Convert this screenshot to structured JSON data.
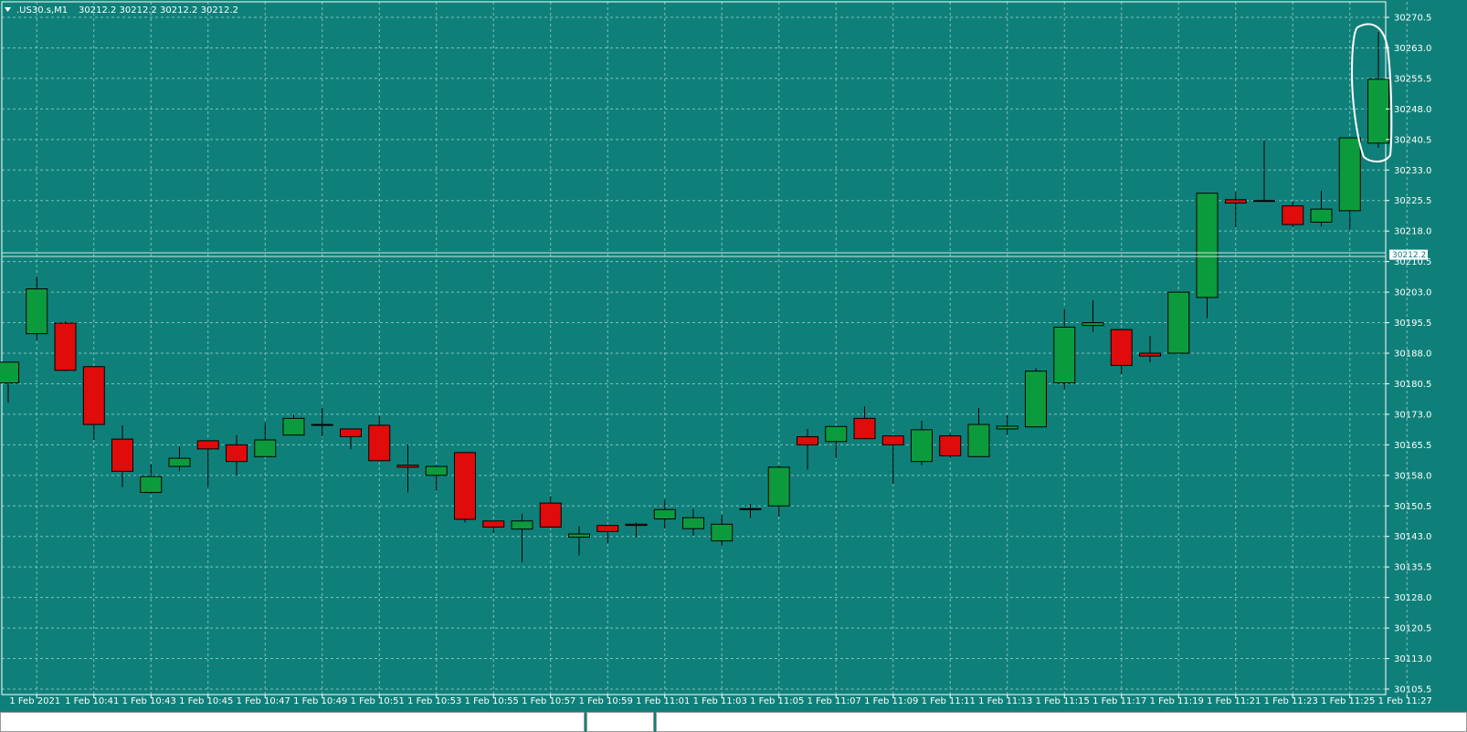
{
  "header": {
    "symbol_label": ".US30.s,M1",
    "ohlc_label": "30212.2 30212.2 30212.2 30212.2",
    "menu_icon": "triangle-down-icon"
  },
  "current_price": {
    "value": 30212.2,
    "label": "30212.2"
  },
  "colors": {
    "background": "#0f8079",
    "grid": "#7fc0bc",
    "bull": "#0c9b3c",
    "bear": "#e00b0b",
    "wick": "#000000",
    "axis_text": "#ffffff",
    "highlight_circle": "#ffffff"
  },
  "chart_data": {
    "type": "candlestick",
    "timeframe": "M1",
    "grid": true,
    "ylim": [
      30105.5,
      30270.5
    ],
    "y_ticks": [
      "30270.5",
      "30263.0",
      "30255.5",
      "30248.0",
      "30240.5",
      "30233.0",
      "30225.5",
      "30218.0",
      "30210.5",
      "30203.0",
      "30195.5",
      "30188.0",
      "30180.5",
      "30173.0",
      "30165.5",
      "30158.0",
      "30150.5",
      "30143.0",
      "30135.5",
      "30128.0",
      "30120.5",
      "30113.0",
      "30105.5"
    ],
    "x_ticks": [
      "1 Feb 2021",
      "1 Feb 10:41",
      "1 Feb 10:43",
      "1 Feb 10:45",
      "1 Feb 10:47",
      "1 Feb 10:49",
      "1 Feb 10:51",
      "1 Feb 10:53",
      "1 Feb 10:55",
      "1 Feb 10:57",
      "1 Feb 10:59",
      "1 Feb 11:01",
      "1 Feb 11:03",
      "1 Feb 11:05",
      "1 Feb 11:07",
      "1 Feb 11:09",
      "1 Feb 11:11",
      "1 Feb 11:13",
      "1 Feb 11:15",
      "1 Feb 11:17",
      "1 Feb 11:19",
      "1 Feb 11:21",
      "1 Feb 11:23",
      "1 Feb 11:25",
      "1 Feb 11:27"
    ],
    "candles": [
      {
        "o": 30180.7,
        "h": 30185.8,
        "l": 30175.9,
        "c": 30185.8
      },
      {
        "o": 30192.8,
        "h": 30206.9,
        "l": 30191.2,
        "c": 30203.8
      },
      {
        "o": 30195.4,
        "h": 30195.8,
        "l": 30183.6,
        "c": 30183.8
      },
      {
        "o": 30184.7,
        "h": 30184.7,
        "l": 30166.7,
        "c": 30170.5
      },
      {
        "o": 30166.9,
        "h": 30170.3,
        "l": 30155.1,
        "c": 30159.0
      },
      {
        "o": 30153.8,
        "h": 30160.8,
        "l": 30153.6,
        "c": 30157.7
      },
      {
        "o": 30160.2,
        "h": 30165.1,
        "l": 30159.0,
        "c": 30162.2
      },
      {
        "o": 30166.5,
        "h": 30166.7,
        "l": 30155.1,
        "c": 30164.5
      },
      {
        "o": 30165.5,
        "h": 30167.9,
        "l": 30158.0,
        "c": 30161.4
      },
      {
        "o": 30162.6,
        "h": 30170.9,
        "l": 30162.6,
        "c": 30166.7
      },
      {
        "o": 30167.9,
        "h": 30173.0,
        "l": 30167.9,
        "c": 30172.0
      },
      {
        "o": 30170.5,
        "h": 30174.6,
        "l": 30167.6,
        "c": 30170.5
      },
      {
        "o": 30169.4,
        "h": 30169.4,
        "l": 30164.4,
        "c": 30167.5
      },
      {
        "o": 30170.3,
        "h": 30172.6,
        "l": 30161.4,
        "c": 30161.6
      },
      {
        "o": 30160.5,
        "h": 30165.6,
        "l": 30153.8,
        "c": 30160.0
      },
      {
        "o": 30158.0,
        "h": 30160.5,
        "l": 30154.2,
        "c": 30160.2
      },
      {
        "o": 30163.6,
        "h": 30163.6,
        "l": 30146.4,
        "c": 30147.2
      },
      {
        "o": 30146.8,
        "h": 30146.8,
        "l": 30143.8,
        "c": 30145.3
      },
      {
        "o": 30144.8,
        "h": 30148.5,
        "l": 30136.6,
        "c": 30146.8
      },
      {
        "o": 30151.2,
        "h": 30152.9,
        "l": 30145.1,
        "c": 30145.3
      },
      {
        "o": 30142.8,
        "h": 30145.5,
        "l": 30138.3,
        "c": 30143.6
      },
      {
        "o": 30145.7,
        "h": 30145.7,
        "l": 30141.4,
        "c": 30144.2
      },
      {
        "o": 30146.0,
        "h": 30146.4,
        "l": 30142.8,
        "c": 30145.7
      },
      {
        "o": 30147.3,
        "h": 30152.0,
        "l": 30144.9,
        "c": 30149.6
      },
      {
        "o": 30144.9,
        "h": 30149.8,
        "l": 30143.2,
        "c": 30147.6
      },
      {
        "o": 30141.9,
        "h": 30148.3,
        "l": 30140.6,
        "c": 30146.0
      },
      {
        "o": 30149.6,
        "h": 30151.0,
        "l": 30147.5,
        "c": 30149.8
      },
      {
        "o": 30150.5,
        "h": 30160.3,
        "l": 30147.9,
        "c": 30160.0
      },
      {
        "o": 30167.5,
        "h": 30169.4,
        "l": 30159.4,
        "c": 30165.5
      },
      {
        "o": 30166.3,
        "h": 30170.0,
        "l": 30162.2,
        "c": 30170.0
      },
      {
        "o": 30172.0,
        "h": 30174.9,
        "l": 30167.0,
        "c": 30167.0
      },
      {
        "o": 30167.7,
        "h": 30167.7,
        "l": 30155.9,
        "c": 30165.5
      },
      {
        "o": 30161.4,
        "h": 30171.4,
        "l": 30160.5,
        "c": 30169.2
      },
      {
        "o": 30167.7,
        "h": 30168.3,
        "l": 30162.2,
        "c": 30162.8
      },
      {
        "o": 30162.6,
        "h": 30174.6,
        "l": 30162.6,
        "c": 30170.5
      },
      {
        "o": 30169.4,
        "h": 30172.8,
        "l": 30167.9,
        "c": 30170.1
      },
      {
        "o": 30169.9,
        "h": 30184.3,
        "l": 30169.9,
        "c": 30183.6
      },
      {
        "o": 30180.7,
        "h": 30198.9,
        "l": 30179.2,
        "c": 30194.4
      },
      {
        "o": 30194.8,
        "h": 30201.0,
        "l": 30193.2,
        "c": 30195.5
      },
      {
        "o": 30193.8,
        "h": 30193.8,
        "l": 30182.8,
        "c": 30185.0
      },
      {
        "o": 30188.0,
        "h": 30192.3,
        "l": 30185.8,
        "c": 30187.3
      },
      {
        "o": 30188.0,
        "h": 30203.0,
        "l": 30188.0,
        "c": 30203.0
      },
      {
        "o": 30201.7,
        "h": 30227.3,
        "l": 30196.6,
        "c": 30227.3
      },
      {
        "o": 30225.7,
        "h": 30227.7,
        "l": 30218.9,
        "c": 30224.9
      },
      {
        "o": 30225.5,
        "h": 30240.3,
        "l": 30225.3,
        "c": 30225.5
      },
      {
        "o": 30224.2,
        "h": 30225.3,
        "l": 30218.9,
        "c": 30219.6
      },
      {
        "o": 30220.2,
        "h": 30227.9,
        "l": 30219.1,
        "c": 30223.4
      },
      {
        "o": 30223.0,
        "h": 30240.9,
        "l": 30218.4,
        "c": 30240.9
      },
      {
        "o": 30239.6,
        "h": 30266.9,
        "l": 30238.5,
        "c": 30255.3
      }
    ]
  }
}
